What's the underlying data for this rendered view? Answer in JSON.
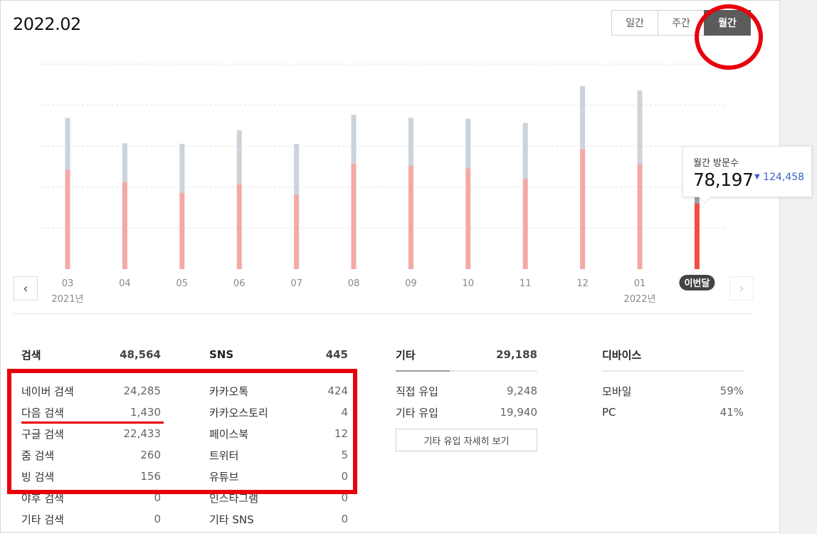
{
  "header": {
    "period_title": "2022.02"
  },
  "period_tabs": [
    {
      "label": "일간",
      "active": false
    },
    {
      "label": "주간",
      "active": false
    },
    {
      "label": "월간",
      "active": true
    }
  ],
  "chart_data": {
    "type": "bar",
    "categories": [
      "03",
      "04",
      "05",
      "06",
      "07",
      "08",
      "09",
      "10",
      "11",
      "12",
      "01",
      "이번달"
    ],
    "year_labels": {
      "start": "2021년",
      "end": "2022년"
    },
    "series": [
      {
        "values": [
          67800,
          59300,
          52000,
          58000,
          51000,
          72000,
          70800,
          68800,
          61500,
          82000,
          71800,
          45000
        ]
      },
      {
        "values": [
          35400,
          26600,
          33600,
          36800,
          34600,
          33400,
          32500,
          33900,
          38300,
          42900,
          50200,
          20900
        ]
      }
    ],
    "ylim": [
      0,
      140000
    ],
    "gridlines": 5,
    "colors": {
      "primary": "#f4a9a4",
      "secondary": "#ccd3da",
      "current_primary": "#f04e43",
      "current_secondary": "#98a3b0"
    }
  },
  "tooltip": {
    "label": "월간 방문수",
    "value": "78,197",
    "prev": "124,458",
    "prev_arrow": "▼"
  },
  "nav": {
    "prev_icon": "‹",
    "next_icon": "›"
  },
  "stats": {
    "search": {
      "title": "검색",
      "total": "48,564",
      "rows": [
        {
          "label": "네이버 검색",
          "value": "24,285"
        },
        {
          "label": "다음 검색",
          "value": "1,430"
        },
        {
          "label": "구글 검색",
          "value": "22,433"
        },
        {
          "label": "줌 검색",
          "value": "260"
        },
        {
          "label": "빙 검색",
          "value": "156"
        },
        {
          "label": "야후 검색",
          "value": "0"
        },
        {
          "label": "기타 검색",
          "value": "0"
        }
      ]
    },
    "sns": {
      "title": "SNS",
      "total": "445",
      "rows": [
        {
          "label": "카카오톡",
          "value": "424"
        },
        {
          "label": "카카오스토리",
          "value": "4"
        },
        {
          "label": "페이스북",
          "value": "12"
        },
        {
          "label": "트위터",
          "value": "5"
        },
        {
          "label": "유튜브",
          "value": "0"
        },
        {
          "label": "인스타그램",
          "value": "0"
        },
        {
          "label": "기타 SNS",
          "value": "0"
        }
      ]
    },
    "etc": {
      "title": "기타",
      "total": "29,188",
      "rows": [
        {
          "label": "직접 유입",
          "value": "9,248"
        },
        {
          "label": "기타 유입",
          "value": "19,940"
        }
      ],
      "more_label": "기타 유입 자세히 보기"
    },
    "device": {
      "title": "디바이스",
      "total": "",
      "rows": [
        {
          "label": "모바일",
          "value": "59%"
        },
        {
          "label": "PC",
          "value": "41%"
        }
      ]
    }
  },
  "annotation_color": "#e8000b"
}
